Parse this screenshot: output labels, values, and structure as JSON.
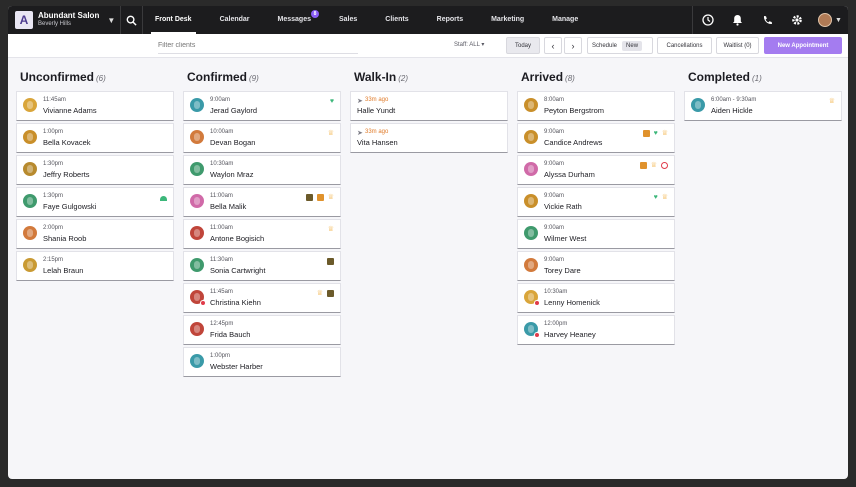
{
  "header": {
    "salon_name": "Abundant Salon",
    "salon_location": "Beverly Hills",
    "nav": [
      {
        "label": "Front Desk",
        "active": true
      },
      {
        "label": "Calendar"
      },
      {
        "label": "Messages",
        "badge": "8"
      },
      {
        "label": "Sales"
      },
      {
        "label": "Clients"
      },
      {
        "label": "Reports"
      },
      {
        "label": "Marketing"
      },
      {
        "label": "Manage"
      }
    ]
  },
  "toolbar": {
    "filter_placeholder": "Filter clients",
    "staff_label": "Staff:",
    "staff_value": "ALL",
    "today": "Today",
    "schedule": "Schedule",
    "schedule_new": "New",
    "cancellations": "Cancellations",
    "waitlist": "Waitlist (0)",
    "new_appointment": "New Appointment"
  },
  "columns": [
    {
      "title": "Unconfirmed",
      "count": "(6)",
      "cards": [
        {
          "time": "11:45am",
          "name": "Vivianne Adams",
          "avatar": "#d9a53a",
          "icons": []
        },
        {
          "time": "1:00pm",
          "name": "Bella Kovacek",
          "avatar": "#c98f2a",
          "icons": []
        },
        {
          "time": "1:30pm",
          "name": "Jeffry Roberts",
          "avatar": "#b78a2e",
          "icons": []
        },
        {
          "time": "1:30pm",
          "name": "Faye Gulgowski",
          "avatar": "#3f9a6d",
          "icons": [
            "mound"
          ]
        },
        {
          "time": "2:00pm",
          "name": "Shania Roob",
          "avatar": "#d27a3c",
          "icons": []
        },
        {
          "time": "2:15pm",
          "name": "Lelah Braun",
          "avatar": "#c99a33",
          "icons": []
        }
      ]
    },
    {
      "title": "Confirmed",
      "count": "(9)",
      "cards": [
        {
          "time": "9:00am",
          "name": "Jerad Gaylord",
          "avatar": "#3a9aa8",
          "icons": [
            "heart"
          ]
        },
        {
          "time": "10:00am",
          "name": "Devan Bogan",
          "avatar": "#d27a3c",
          "icons": [
            "crown"
          ]
        },
        {
          "time": "10:30am",
          "name": "Waylon Mraz",
          "avatar": "#3f9a6d",
          "icons": []
        },
        {
          "time": "11:00am",
          "name": "Bella Malik",
          "avatar": "#d06aa8",
          "icons": [
            "card-dark",
            "card",
            "crown"
          ]
        },
        {
          "time": "11:00am",
          "name": "Antone Bogisich",
          "avatar": "#c0453a",
          "icons": [
            "crown"
          ]
        },
        {
          "time": "11:30am",
          "name": "Sonia Cartwright",
          "avatar": "#3f9a6d",
          "icons": [
            "card-dark"
          ]
        },
        {
          "time": "11:45am",
          "name": "Christina Kiehn",
          "avatar": "#c0453a",
          "alert": true,
          "icons": [
            "crown",
            "card-dark"
          ]
        },
        {
          "time": "12:45pm",
          "name": "Frida Bauch",
          "avatar": "#c0453a",
          "icons": []
        },
        {
          "time": "1:00pm",
          "name": "Webster Harber",
          "avatar": "#3a9aa8",
          "icons": []
        }
      ]
    },
    {
      "title": "Walk-In",
      "count": "(2)",
      "cards": [
        {
          "time": "33m ago",
          "name": "Halle Yundt",
          "walk": true,
          "icons": []
        },
        {
          "time": "33m ago",
          "name": "Vita Hansen",
          "walk": true,
          "icons": []
        }
      ]
    },
    {
      "title": "Arrived",
      "count": "(8)",
      "cards": [
        {
          "time": "8:00am",
          "name": "Peyton Bergstrom",
          "avatar": "#c98f2a",
          "icons": []
        },
        {
          "time": "9:00am",
          "name": "Candice Andrews",
          "avatar": "#c98f2a",
          "icons": [
            "card",
            "heart",
            "crown"
          ]
        },
        {
          "time": "9:00am",
          "name": "Alyssa Durham",
          "avatar": "#d06aa8",
          "icons": [
            "card",
            "crown",
            "noshow"
          ]
        },
        {
          "time": "9:00am",
          "name": "Vickie Rath",
          "avatar": "#c98f2a",
          "icons": [
            "heart",
            "crown"
          ]
        },
        {
          "time": "9:00am",
          "name": "Wilmer West",
          "avatar": "#3f9a6d",
          "icons": []
        },
        {
          "time": "9:00am",
          "name": "Torey Dare",
          "avatar": "#d27a3c",
          "icons": []
        },
        {
          "time": "10:30am",
          "name": "Lenny Homenick",
          "avatar": "#d9a53a",
          "alert": true,
          "icons": []
        },
        {
          "time": "12:00pm",
          "name": "Harvey Heaney",
          "avatar": "#3a9aa8",
          "alert": true,
          "icons": []
        }
      ]
    },
    {
      "title": "Completed",
      "count": "(1)",
      "cards": [
        {
          "time": "6:00am - 9:30am",
          "name": "Aiden Hickle",
          "avatar": "#3a9aa8",
          "icons": [
            "crown"
          ]
        }
      ]
    }
  ]
}
